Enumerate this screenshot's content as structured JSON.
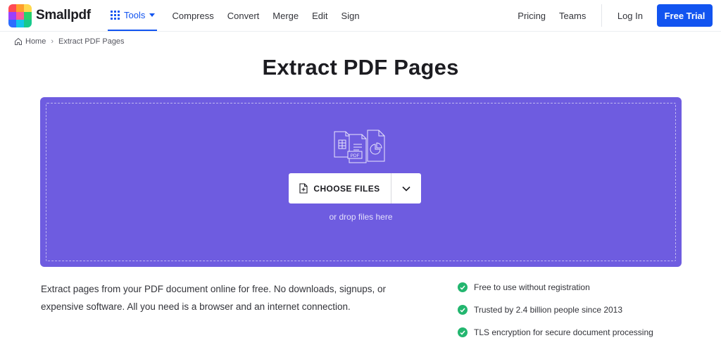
{
  "brand": {
    "name": "Smallpdf",
    "logo_colors": [
      "#ff4a54",
      "#ff9e2b",
      "#ffd84d",
      "#9a3fff",
      "#ff5a95",
      "#2ad16d",
      "#2b6cff",
      "#14c4e9",
      "#17c98c"
    ]
  },
  "nav": {
    "tools_label": "Tools",
    "items": [
      "Compress",
      "Convert",
      "Merge",
      "Edit",
      "Sign"
    ],
    "right_items": [
      "Pricing",
      "Teams"
    ],
    "login_label": "Log In",
    "cta_label": "Free Trial"
  },
  "breadcrumb": {
    "home": "Home",
    "separator": "›",
    "current": "Extract PDF Pages"
  },
  "page": {
    "title": "Extract PDF Pages"
  },
  "dropzone": {
    "button_label": "CHOOSE FILES",
    "hint": "or drop files here",
    "illustration_badge": "PDF"
  },
  "description": "Extract pages from your PDF document online for free. No downloads, signups, or expensive software. All you need is a browser and an internet connection.",
  "features": [
    "Free to use without registration",
    "Trusted by 2.4 billion people since 2013",
    "TLS encryption for secure document processing"
  ],
  "colors": {
    "accent": "#1254f0",
    "dropzone": "#6e5ce0",
    "check": "#23b66f"
  },
  "icons": {
    "tools": "grid-icon",
    "home": "home-icon",
    "file": "file-plus-icon",
    "dropdown": "chevron-down-icon",
    "feature": "check-circle-icon"
  }
}
